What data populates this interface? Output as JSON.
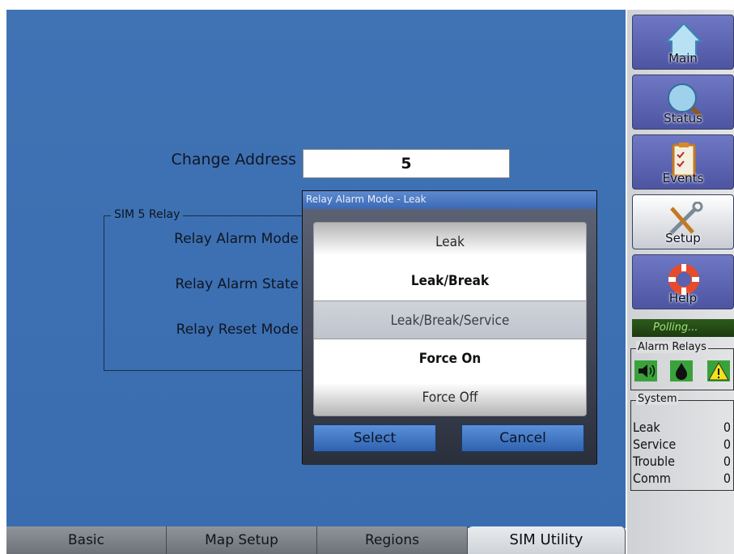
{
  "form": {
    "change_address_label": "Change Address",
    "change_address_value": "5",
    "relay_group_title": "SIM 5 Relay",
    "relay_alarm_mode_label": "Relay Alarm Mode",
    "relay_alarm_state_label": "Relay Alarm State",
    "relay_reset_mode_label": "Relay Reset Mode"
  },
  "dialog": {
    "title": "Relay Alarm Mode - Leak",
    "options": [
      {
        "label": "Leak",
        "selected": false
      },
      {
        "label": "Leak/Break",
        "selected": false
      },
      {
        "label": "Leak/Break/Service",
        "selected": true
      },
      {
        "label": "Force On",
        "selected": false
      },
      {
        "label": "Force Off",
        "selected": false
      }
    ],
    "select_label": "Select",
    "cancel_label": "Cancel"
  },
  "tabs": [
    {
      "label": "Basic",
      "active": false
    },
    {
      "label": "Map Setup",
      "active": false
    },
    {
      "label": "Regions",
      "active": false
    },
    {
      "label": "SIM Utility",
      "active": true
    }
  ],
  "sidebar": {
    "nav": [
      {
        "label": "Main",
        "icon": "home-icon",
        "active": false
      },
      {
        "label": "Status",
        "icon": "magnifier-icon",
        "active": false
      },
      {
        "label": "Events",
        "icon": "clipboard-icon",
        "active": false
      },
      {
        "label": "Setup",
        "icon": "wrench-screwdriver-icon",
        "active": true
      },
      {
        "label": "Help",
        "icon": "lifebuoy-icon",
        "active": false
      }
    ],
    "polling_text": "Polling...",
    "alarm_relays_title": "Alarm Relays",
    "alarm_relay_icons": [
      "speaker-icon",
      "water-drop-icon",
      "warning-triangle-icon"
    ],
    "system_title": "System",
    "system_rows": [
      {
        "label": "Leak",
        "value": "0"
      },
      {
        "label": "Service",
        "value": "0"
      },
      {
        "label": "Trouble",
        "value": "0"
      },
      {
        "label": "Comm",
        "value": "0"
      }
    ]
  },
  "colors": {
    "panel_blue": "#3d71b2",
    "nav_purple": "#5a62b0",
    "dialog_button_blue": "#3f78c6",
    "polling_green": "#1c3b10"
  }
}
